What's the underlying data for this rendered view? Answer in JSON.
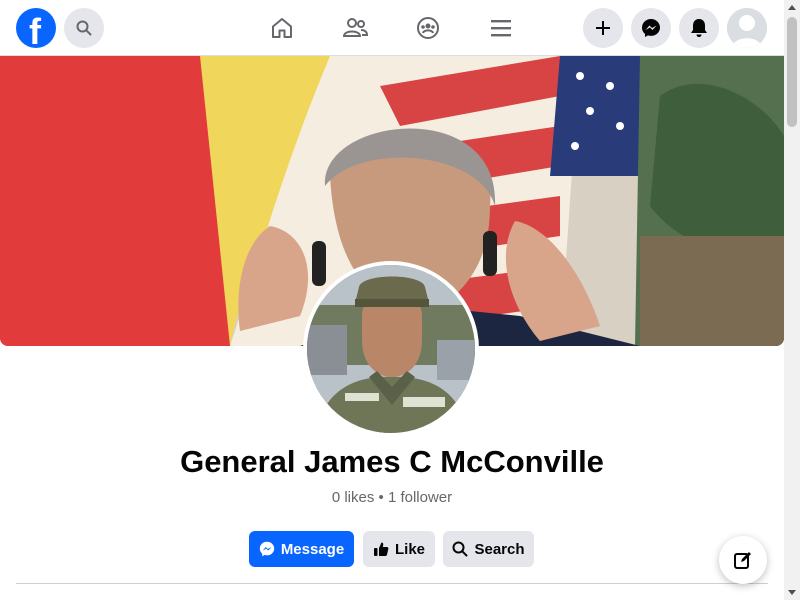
{
  "topbar": {
    "logo_letter": "f",
    "icons": [
      "search-icon",
      "home-icon",
      "friends-icon",
      "groups-icon",
      "menu-icon",
      "plus-icon",
      "messenger-icon",
      "bell-icon",
      "profile-icon"
    ]
  },
  "profile": {
    "name": "General James C McConville",
    "stats": "0 likes • 1 follower"
  },
  "actions": {
    "message_label": "Message",
    "like_label": "Like",
    "search_label": "Search"
  },
  "colors": {
    "accent": "#0866ff",
    "secondary_button": "#e4e6eb",
    "text_primary": "#050505",
    "text_secondary": "#65676b"
  }
}
